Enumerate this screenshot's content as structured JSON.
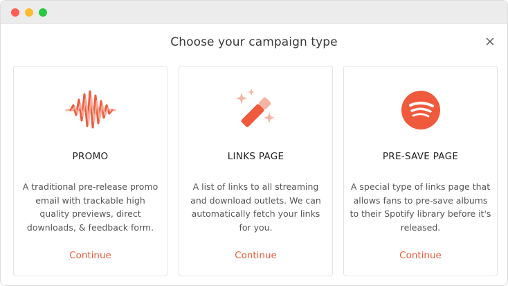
{
  "modal": {
    "title": "Choose your campaign type",
    "close_icon": "close-icon"
  },
  "colors": {
    "accent": "#f05a3c",
    "icon_light": "#f6b3a4"
  },
  "cards": [
    {
      "icon": "soundwave-icon",
      "heading": "PROMO",
      "description": "A traditional pre-release promo email with trackable high quality previews, direct downloads, & feedback form.",
      "cta": "Continue"
    },
    {
      "icon": "magic-wand-icon",
      "heading": "LINKS PAGE",
      "description": "A list of links to all streaming and download outlets. We can automatically fetch your links for you.",
      "cta": "Continue"
    },
    {
      "icon": "spotify-icon",
      "heading": "PRE-SAVE PAGE",
      "description": "A special type of links page that allows fans to pre-save albums to their Spotify library before it's released.",
      "cta": "Continue"
    }
  ]
}
